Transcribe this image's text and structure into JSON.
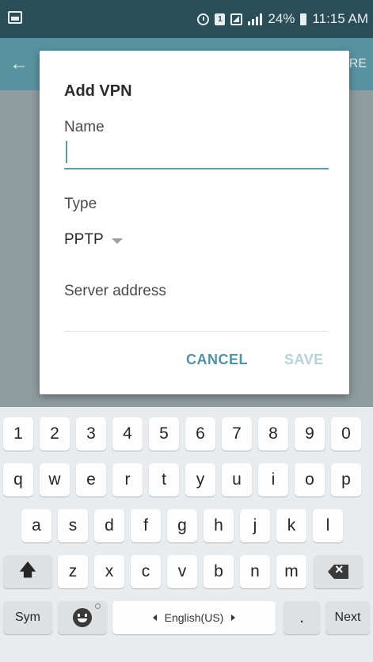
{
  "status_bar": {
    "battery_percent": "24%",
    "time": "11:15 AM",
    "icons": [
      "gallery-icon",
      "alarm-icon",
      "sim-icon",
      "network-icon",
      "signal-icon",
      "battery-icon"
    ],
    "sim_label": "1"
  },
  "app_bar": {
    "back_icon": "back-arrow-icon",
    "right_text": "RE"
  },
  "dialog": {
    "title": "Add VPN",
    "name_label": "Name",
    "name_value": "",
    "type_label": "Type",
    "type_value": "PPTP",
    "server_label": "Server address",
    "cancel_label": "CANCEL",
    "save_label": "SAVE"
  },
  "keyboard": {
    "numbers": [
      "1",
      "2",
      "3",
      "4",
      "5",
      "6",
      "7",
      "8",
      "9",
      "0"
    ],
    "row1": [
      "q",
      "w",
      "e",
      "r",
      "t",
      "y",
      "u",
      "i",
      "o",
      "p"
    ],
    "row2": [
      "a",
      "s",
      "d",
      "f",
      "g",
      "h",
      "j",
      "k",
      "l"
    ],
    "row3": [
      "z",
      "x",
      "c",
      "v",
      "b",
      "n",
      "m"
    ],
    "shift_icon": "shift-arrow-icon",
    "backspace_icon": "backspace-icon",
    "sym_label": "Sym",
    "emoji_icon": "emoji-icon",
    "space_label": "English(US)",
    "period_label": ".",
    "next_label": "Next"
  },
  "colors": {
    "status_bar": "#2b4d57",
    "app_bar": "#58929f",
    "accent": "#4f93a5",
    "save_disabled": "#b8d2d9",
    "keyboard_bg": "#e8ecef"
  }
}
